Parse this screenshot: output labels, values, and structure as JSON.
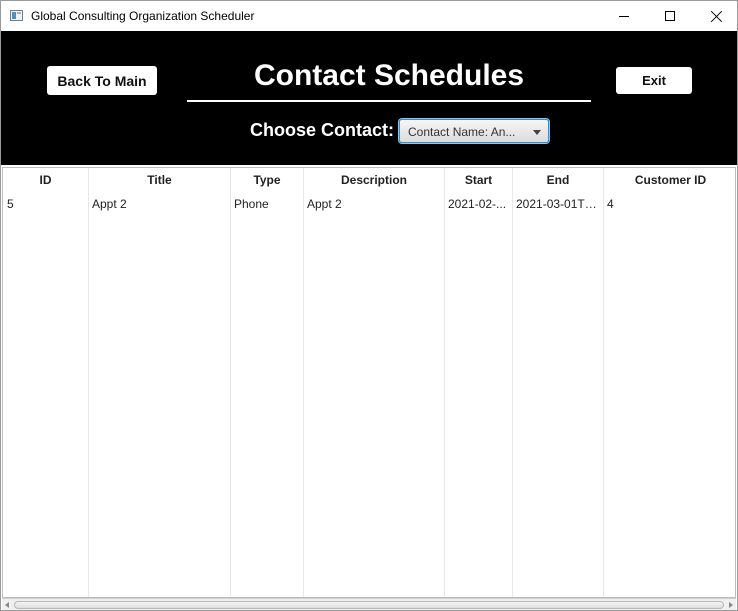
{
  "window": {
    "title": "Global Consulting Organization Scheduler",
    "icon": "app-window-icon",
    "controls": [
      "minimize-icon",
      "maximize-icon",
      "close-icon"
    ]
  },
  "header": {
    "back_label": "Back To Main",
    "title": "Contact Schedules",
    "exit_label": "Exit",
    "choose_label": "Choose Contact:",
    "contact_select": {
      "value": "Contact Name: An..."
    }
  },
  "table": {
    "columns": [
      "ID",
      "Title",
      "Type",
      "Description",
      "Start",
      "End",
      "Customer ID"
    ],
    "rows": [
      [
        "5",
        "Appt 2",
        "Phone",
        "Appt 2",
        "2021-02-...",
        "2021-03-01T0...",
        "4"
      ]
    ]
  },
  "colors": {
    "header_background": "#000000",
    "focus_accent": "#2d8fd5"
  }
}
